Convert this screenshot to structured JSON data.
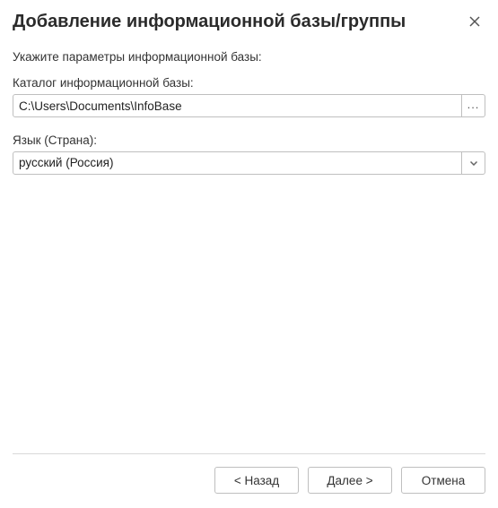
{
  "header": {
    "title": "Добавление информационной базы/группы"
  },
  "body": {
    "instruction": "Укажите параметры информационной базы:",
    "catalog": {
      "label": "Каталог информационной базы:",
      "value": "C:\\Users\\Documents\\InfoBase",
      "browse_label": "..."
    },
    "language": {
      "label": "Язык (Страна):",
      "value": "русский (Россия)"
    }
  },
  "footer": {
    "back_label": "< Назад",
    "next_label": "Далее >",
    "cancel_label": "Отмена"
  }
}
